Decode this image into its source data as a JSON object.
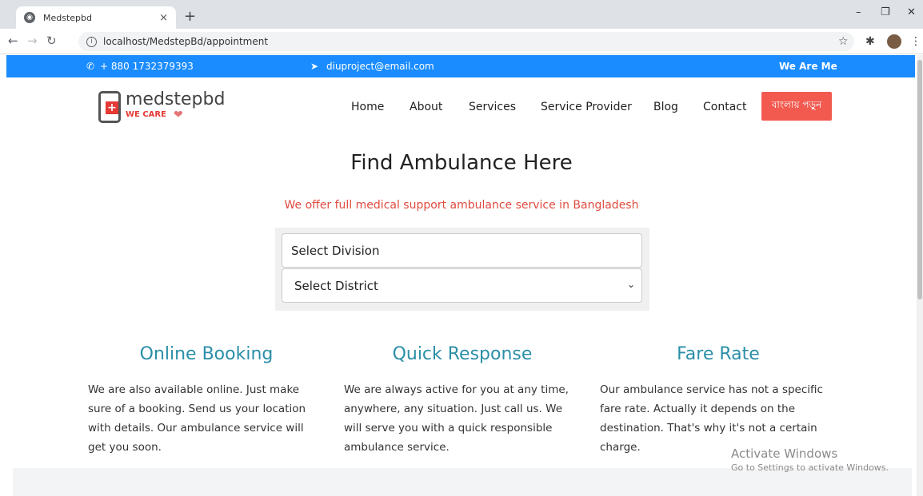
{
  "browser": {
    "tab_title": "Medstepbd",
    "tab_close": "×",
    "new_tab": "+",
    "url": "localhost/MedstepBd/appointment",
    "win_minimize": "–",
    "win_restore": "❐",
    "win_close": "✕"
  },
  "topbar": {
    "phone": "+ 880 1732379393",
    "email": "diuproject@email.com",
    "marquee": "We Are Me"
  },
  "logo": {
    "brand": "medstepbd",
    "tagline": "WE CARE"
  },
  "nav": {
    "items": [
      "Home",
      "About",
      "Services",
      "Service Provider",
      "Blog",
      "Contact"
    ],
    "cta": "বাংলায় পড়ুন"
  },
  "hero": {
    "title": "Find Ambulance Here",
    "subtitle": "We offer full medical support ambulance service in Bangladesh"
  },
  "form": {
    "division": "Select Division",
    "district": "Select District"
  },
  "features": [
    {
      "title": "Online Booking",
      "text": "We are also available online. Just make sure of a booking. Send us your location with details. Our ambulance service will get you soon."
    },
    {
      "title": "Quick Response",
      "text": "We are always active for you at any time, anywhere, any situation. Just call us. We will serve you with a quick responsible ambulance service."
    },
    {
      "title": "Fare Rate",
      "text": "Our ambulance service has not a specific fare rate. Actually it depends on the destination. That's why it's not a certain charge."
    }
  ],
  "watermark": {
    "line1": "Activate Windows",
    "line2": "Go to Settings to activate Windows."
  },
  "colors": {
    "topbar": "#1a8cff",
    "cta": "#f25a50",
    "feature_title": "#2b8fa8",
    "subtitle": "#e04a3f"
  }
}
